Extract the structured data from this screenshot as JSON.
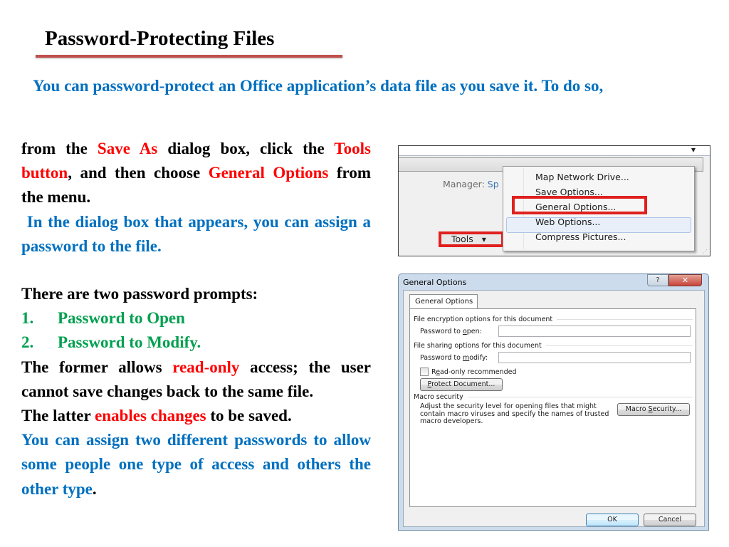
{
  "slide": {
    "title": "Password-Protecting Files",
    "intro": "You can password-protect an Office application’s data file as you save it. To do so,",
    "block1": {
      "p1": {
        "t1": "from the ",
        "r1": "Save As",
        "t2": " dialog box, click the ",
        "r2": "Tools button",
        "t3": ", and then choose ",
        "r3": "General Options",
        "t4": " from the menu."
      },
      "p2": " In the dialog box that appears, you can assign a password to the file."
    },
    "block2": {
      "heading": "There are two password prompts:",
      "list": [
        {
          "num": "1.",
          "text": "Password to Open"
        },
        {
          "num": "2.",
          "text": "Password to Modify."
        }
      ],
      "former": {
        "t1": "The former allows ",
        "r1": "read-only",
        "t2": " access; the user cannot save changes back to the same file."
      },
      "latter": {
        "t1": "The latter ",
        "r1": "enables changes",
        "t2": " to be saved."
      },
      "closing": {
        "b1": "You can assign two different passwords to allow some people one type of access and others the other type",
        "t2": "."
      }
    }
  },
  "save_as_screenshot": {
    "manager_label": "Manager:",
    "manager_value": "Sp",
    "tools_button": "Tools",
    "menu_items": [
      "Map Network Drive...",
      "Save Options...",
      "General Options...",
      "Web Options...",
      "Compress Pictures..."
    ],
    "highlighted_item": "General Options..."
  },
  "general_options_dialog": {
    "title": "General Options",
    "help_glyph": "?",
    "close_glyph": "✕",
    "tab": "General Options",
    "encryption_group": "File encryption options for this document",
    "password_open_label": {
      "pre": "Password to ",
      "u": "o",
      "post": "pen:"
    },
    "password_open_value": "",
    "sharing_group": "File sharing options for this document",
    "password_modify_label": {
      "pre": "Password to ",
      "u": "m",
      "post": "odify:"
    },
    "password_modify_value": "",
    "readonly_label": {
      "pre": "R",
      "u": "e",
      "post": "ad-only recommended"
    },
    "readonly_checked": false,
    "protect_button": {
      "u": "P",
      "post": "rotect Document..."
    },
    "macro_group": "Macro security",
    "macro_desc": "Adjust the security level for opening files that might contain macro viruses and specify the names of trusted macro developers.",
    "macro_button": {
      "pre": "Macro ",
      "u": "S",
      "post": "ecurity..."
    },
    "ok_button": "OK",
    "cancel_button": "Cancel"
  },
  "colors": {
    "title_rule": "#c0504d",
    "blue_text": "#0070c0",
    "red_text": "#ff0000",
    "green_text": "#00a04f",
    "highlight_box": "#e0201e"
  }
}
